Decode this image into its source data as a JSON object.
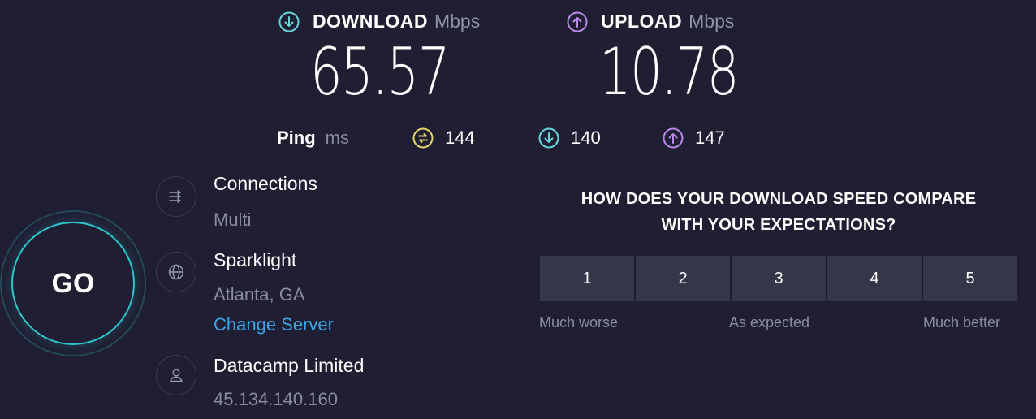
{
  "download": {
    "label": "DOWNLOAD",
    "unit": "Mbps",
    "value": "65.57",
    "icon": "download-arrow-icon",
    "color": "#6ad4d9"
  },
  "upload": {
    "label": "UPLOAD",
    "unit": "Mbps",
    "value": "10.78",
    "icon": "upload-arrow-icon",
    "color": "#b98ae6"
  },
  "ping": {
    "label": "Ping",
    "unit": "ms",
    "idle": {
      "value": "144",
      "icon": "ping-idle-icon",
      "color": "#e6d56a"
    },
    "download": {
      "value": "140",
      "icon": "ping-download-icon",
      "color": "#6ad4d9"
    },
    "upload": {
      "value": "147",
      "icon": "ping-upload-icon",
      "color": "#b98ae6"
    }
  },
  "go_button": {
    "label": "GO",
    "accent": "#2fc6c9"
  },
  "connections": {
    "title": "Connections",
    "value": "Multi",
    "icon": "connections-icon"
  },
  "server": {
    "title": "Sparklight",
    "location": "Atlanta, GA",
    "change_link": "Change Server",
    "icon": "globe-icon"
  },
  "provider": {
    "title": "Datacamp Limited",
    "ip": "45.134.140.160",
    "icon": "user-icon"
  },
  "survey": {
    "question_line1": "HOW DOES YOUR DOWNLOAD SPEED COMPARE",
    "question_line2": "WITH YOUR EXPECTATIONS?",
    "options": [
      "1",
      "2",
      "3",
      "4",
      "5"
    ],
    "scale_low": "Much worse",
    "scale_mid": "As expected",
    "scale_high": "Much better"
  }
}
